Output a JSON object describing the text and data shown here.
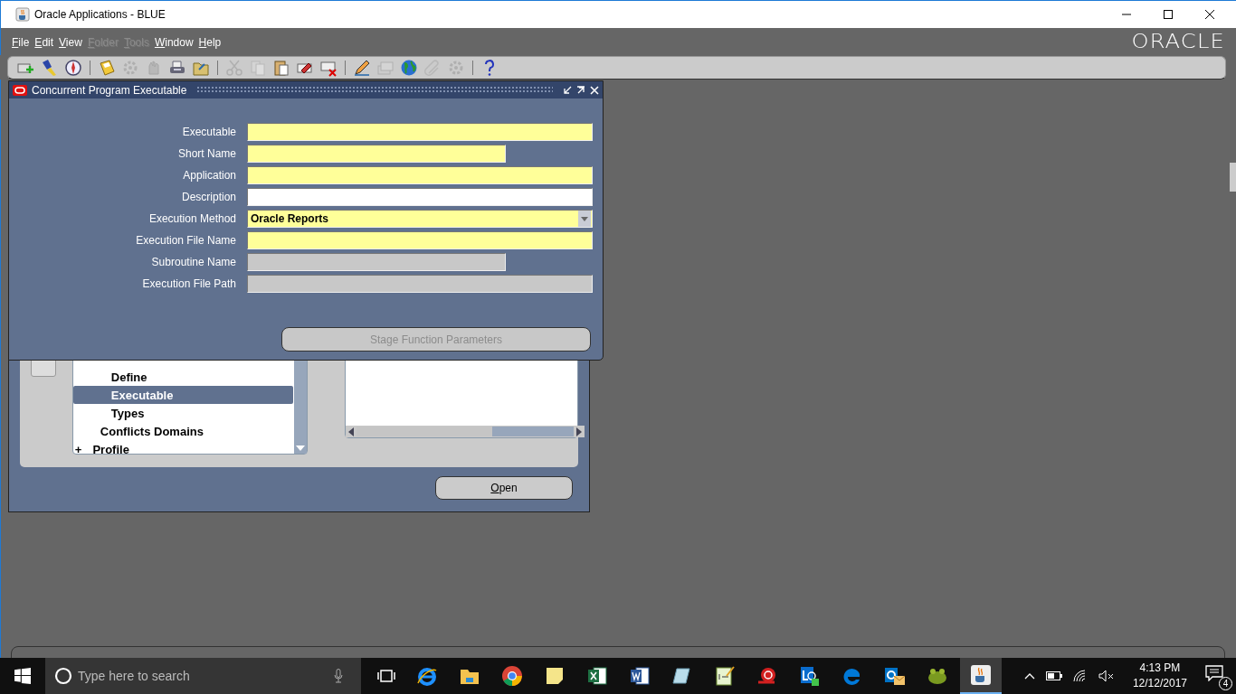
{
  "window": {
    "title": "Oracle Applications - BLUE"
  },
  "menu": [
    {
      "label": "File",
      "disabled": false
    },
    {
      "label": "Edit",
      "disabled": false
    },
    {
      "label": "View",
      "disabled": false
    },
    {
      "label": "Folder",
      "disabled": true
    },
    {
      "label": "Tools",
      "disabled": true
    },
    {
      "label": "Window",
      "disabled": false
    },
    {
      "label": "Help",
      "disabled": false
    }
  ],
  "logo": "ORACLE",
  "toolbar": [
    {
      "kind": "new",
      "disabled": false
    },
    {
      "kind": "find",
      "disabled": false
    },
    {
      "kind": "navigate",
      "disabled": false
    },
    {
      "kind": "separator"
    },
    {
      "kind": "save",
      "disabled": false
    },
    {
      "kind": "gear",
      "disabled": true
    },
    {
      "kind": "hand",
      "disabled": true
    },
    {
      "kind": "print",
      "disabled": false
    },
    {
      "kind": "folder",
      "disabled": false
    },
    {
      "kind": "separator"
    },
    {
      "kind": "cut",
      "disabled": true
    },
    {
      "kind": "copy",
      "disabled": true
    },
    {
      "kind": "paste",
      "disabled": false
    },
    {
      "kind": "eraser",
      "disabled": false
    },
    {
      "kind": "delete",
      "disabled": false
    },
    {
      "kind": "separator"
    },
    {
      "kind": "pencil",
      "disabled": false
    },
    {
      "kind": "stack",
      "disabled": true
    },
    {
      "kind": "globe",
      "disabled": false
    },
    {
      "kind": "clip",
      "disabled": true
    },
    {
      "kind": "gear",
      "disabled": true
    },
    {
      "kind": "separator"
    },
    {
      "kind": "help",
      "disabled": false
    }
  ],
  "dialog": {
    "title": "Concurrent Program Executable",
    "fields": [
      {
        "label": "Executable",
        "kind": "required",
        "short": false
      },
      {
        "label": "Short Name",
        "kind": "required",
        "short": true
      },
      {
        "label": "Application",
        "kind": "required",
        "short": false
      },
      {
        "label": "Description",
        "kind": "optional",
        "short": false
      },
      {
        "label": "Execution Method",
        "kind": "list",
        "short": false,
        "value": "Oracle Reports"
      },
      {
        "label": "Execution File Name",
        "kind": "required",
        "short": false
      },
      {
        "label": "Subroutine Name",
        "kind": "disabled",
        "short": true
      },
      {
        "label": "Execution File Path",
        "kind": "disabled",
        "short": false
      }
    ],
    "button": {
      "label": "Stage Function Parameters",
      "disabled": true
    }
  },
  "navigator": {
    "tree": [
      {
        "children": [
          {
            "label": "Define",
            "selected": false
          },
          {
            "label": "Executable",
            "selected": true
          },
          {
            "label": "Types",
            "selected": false
          }
        ]
      },
      {
        "label": "Conflicts Domains",
        "selected": false
      },
      {
        "label": "Profile",
        "selected": false,
        "expanded": false,
        "expander": "+"
      }
    ],
    "button": "Open"
  },
  "taskbar": {
    "search": {
      "placeholder": "Type here to search"
    },
    "time": "4:13 PM",
    "date": "12/12/2017",
    "notifications": "4"
  }
}
